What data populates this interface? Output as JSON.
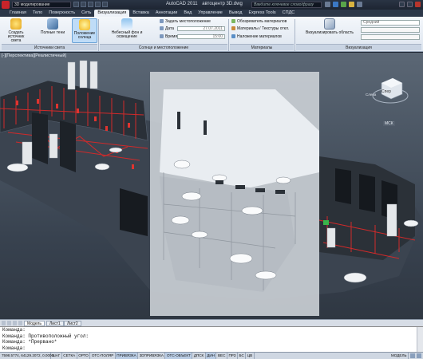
{
  "titlebar": {
    "workspace": "3D моделирование",
    "app_title": "AutoCAD 2011",
    "document": "автоцентр 3D.dwg",
    "search_placeholder": "Введите ключевое слово/фразу"
  },
  "tabs": [
    "Главная",
    "Тело",
    "Поверхность",
    "Сеть",
    "Визуализация",
    "Вставка",
    "Аннотации",
    "Вид",
    "Управление",
    "Вывод",
    "Express Tools",
    "СПДС"
  ],
  "active_tab": "Визуализация",
  "ribbon": {
    "create_light": "Создать источник света",
    "full_shadows": "Полные тени",
    "sun_position": "Положение солнца",
    "sky_bg": "Небесный фон и освещение",
    "set_location": "Задать местоположение",
    "date_label": "Дата",
    "date_value": "27.07.2011",
    "time_label": "Время",
    "time_value": "15:00",
    "materials_browser": "Обозреватель материалов",
    "materials_textures": "Материалы / Текстуры откл.",
    "apply_materials": "Наложение материалов",
    "render_area": "Визуализировать область",
    "quality": "Средний",
    "panels": {
      "lights": "Источники света",
      "sun": "Солнце и местоположение",
      "materials": "Материалы",
      "render": "Визуализация"
    }
  },
  "viewport": {
    "label": "[-][Перспектива][Реалистичный]",
    "viewcube": {
      "face": "Спер",
      "left": "Слева",
      "wcs": "МСК"
    }
  },
  "layout_tabs": [
    "Модель",
    "Лист1",
    "Лист2"
  ],
  "active_layout": "Модель",
  "command_lines": [
    "Команда:",
    "Команда: Противоположный угол:",
    "Команда: *Прервано*",
    "Команда:"
  ],
  "statusbar": {
    "coords": "7598.5774, 64129.2072, 0.0000",
    "toggles": [
      "ШАГ",
      "СЕТКА",
      "ОРТО",
      "ОТС-ПОЛЯР",
      "ПРИВЯЗКА",
      "3DПРИВЯЗКА",
      "ОТС-ОБЪЕКТ",
      "ДПСК",
      "ДИН",
      "ВЕС",
      "ПРЗ",
      "БС",
      "ЦВ"
    ],
    "model": "МОДЕЛЬ"
  },
  "colors": {
    "accent_red": "#d12a2a",
    "viewport_bg": "#4a5563",
    "glass": "#c9ced4"
  }
}
